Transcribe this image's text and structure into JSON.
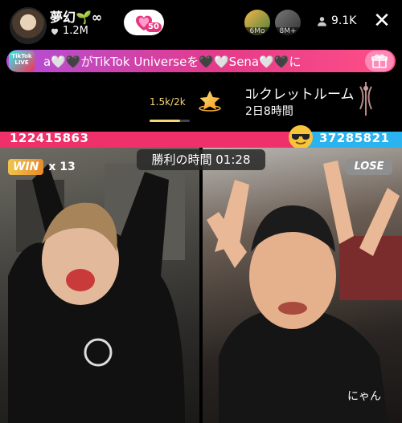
{
  "header": {
    "host_name": "夢幻🌱∞",
    "host_likes": "1.2M",
    "gift_badge_count": "50",
    "viewers": [
      {
        "tag": "6Mo"
      },
      {
        "tag": "8M+"
      }
    ],
    "viewer_count": "9.1K",
    "close_icon": "✕"
  },
  "banner": {
    "logo_text": "TikTok LIVE",
    "text": "a🤍🖤がTikTok Universeを🖤🤍Sena🤍🖤に"
  },
  "goal": {
    "progress_text": "1.5k/2k",
    "progress_value": 0.75
  },
  "room": {
    "title": "ｺﾚクレットルーム",
    "countdown": "2日8時間"
  },
  "battle": {
    "score_left": "122415863",
    "score_right": "37285821",
    "timer": "勝利の時間  01:28",
    "win_label": "WIN",
    "win_streak": "x 13",
    "lose_label": "LOSE",
    "right_nickname": "にゃん"
  },
  "colors": {
    "pink": "#f0306a",
    "blue": "#2bb3f0",
    "gold": "#f7d774"
  }
}
